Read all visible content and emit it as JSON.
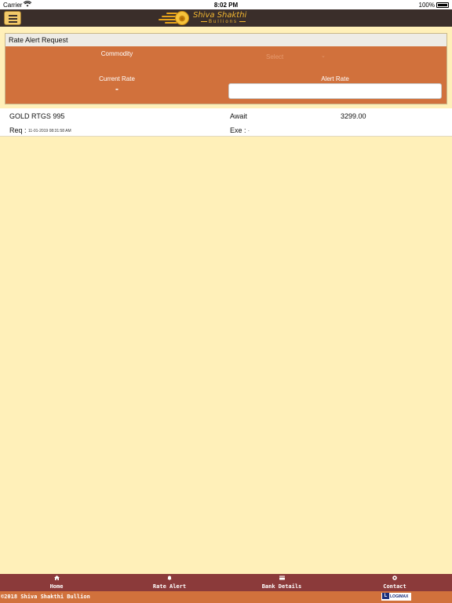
{
  "status_bar": {
    "carrier": "Carrier",
    "time": "8:02 PM",
    "battery": "100%"
  },
  "header": {
    "brand": "Shiva Shakthi",
    "brand_sub": "Bullions"
  },
  "form": {
    "title": "Rate Alert Request",
    "commodity_label": "Commodity",
    "commodity_value": "Select",
    "current_rate_label": "Current Rate",
    "current_rate_value": "-",
    "alert_rate_label": "Alert Rate",
    "alert_rate_value": ""
  },
  "alerts": [
    {
      "commodity": "GOLD RTGS 995",
      "status": "Await",
      "rate": "3299.00",
      "req_label": "Req :",
      "req_value": "11-01-2019 08:31:58 AM",
      "exe_label": "Exe :",
      "exe_value": "-"
    }
  ],
  "tabs": [
    {
      "label": "Home",
      "icon": "home-icon"
    },
    {
      "label": "Rate Alert",
      "icon": "bell-icon"
    },
    {
      "label": "Bank Details",
      "icon": "bank-icon"
    },
    {
      "label": "Contact",
      "icon": "contact-icon"
    }
  ],
  "footer": {
    "copyright": "©2018 Shiva Shakthi Bullion",
    "vendor": "LOGIMAX"
  },
  "colors": {
    "background": "#fff0b9",
    "nav": "#3a2e2a",
    "panel": "#d1713c",
    "tab_bar": "#8b3a3a",
    "gold": "#f2b630"
  }
}
